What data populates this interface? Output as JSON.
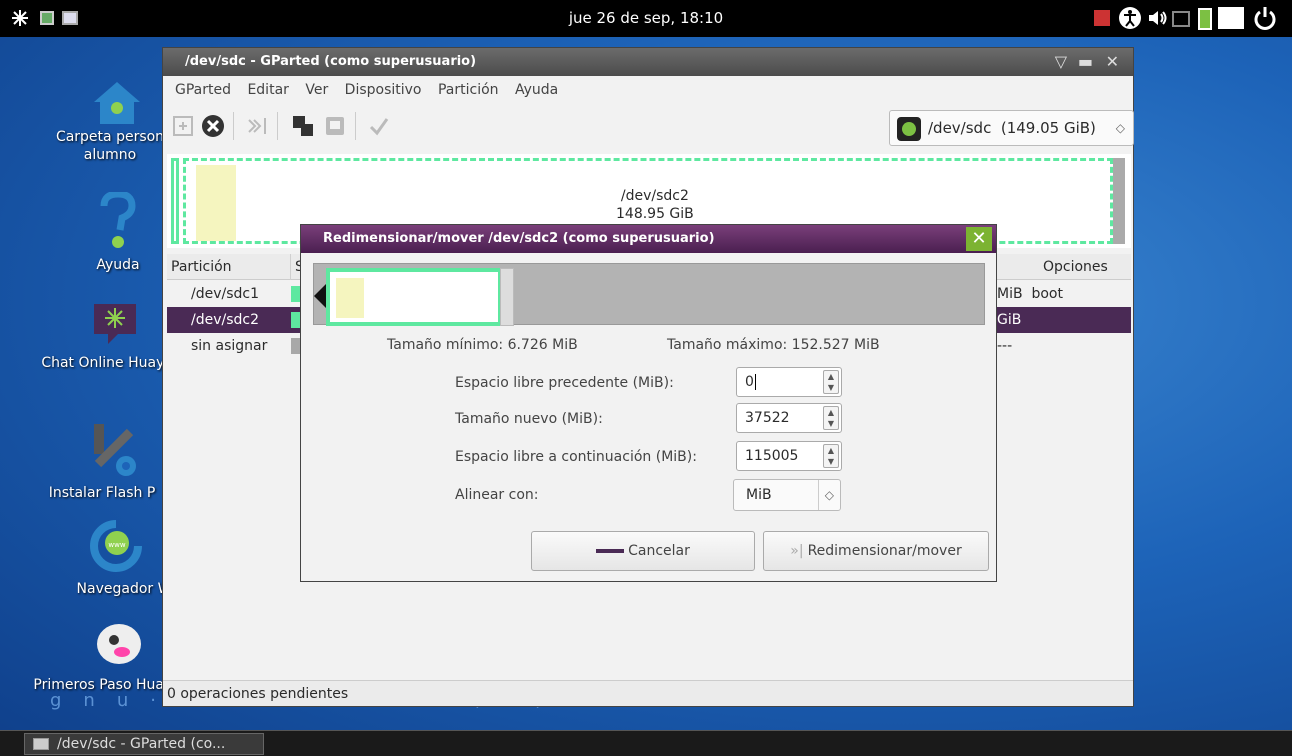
{
  "topbar": {
    "clock": "jue 26 de sep, 18:10"
  },
  "desktop": {
    "icons": [
      {
        "label": "Carpeta person alumno"
      },
      {
        "label": "Ayuda"
      },
      {
        "label": "Chat Online Huayra"
      },
      {
        "label": "Instalar Flash P"
      },
      {
        "label": "Navegador W"
      },
      {
        "label": "Primeros Paso Huayra"
      }
    ],
    "brand": "gnu·t·i·n·u·+·/·\\"
  },
  "taskbar": {
    "window_button": "/dev/sdc - GParted (co..."
  },
  "main_window": {
    "title": "/dev/sdc - GParted (como superusuario)",
    "menu": [
      "GParted",
      "Editar",
      "Ver",
      "Dispositivo",
      "Partición",
      "Ayuda"
    ],
    "device_selector": "/dev/sdc  (149.05 GiB)",
    "graph": {
      "partition": "/dev/sdc2",
      "size": "148.95 GiB"
    },
    "list": {
      "headers": {
        "partition": "Partición",
        "fs_initial": "S",
        "options": "Opciones"
      },
      "rows": [
        {
          "name": "/dev/sdc1",
          "right": "MiB  boot",
          "color": "#5ee8a0"
        },
        {
          "name": "/dev/sdc2",
          "right": "GiB",
          "color": "#5ee8a0"
        },
        {
          "name": "sin asignar",
          "right": "---",
          "color": "#a8a8a8"
        }
      ]
    },
    "status": "0 operaciones pendientes"
  },
  "dialog": {
    "title": "Redimensionar/mover /dev/sdc2 (como superusuario)",
    "min_size": "Tamaño mínimo: 6.726 MiB",
    "max_size": "Tamaño máximo: 152.527 MiB",
    "fields": {
      "free_before_label": "Espacio libre precedente (MiB):",
      "free_before_value": "0",
      "new_size_label": "Tamaño nuevo (MiB):",
      "new_size_value": "37522",
      "free_after_label": "Espacio libre a continuación (MiB):",
      "free_after_value": "115005",
      "align_label": "Alinear con:",
      "align_value": "MiB"
    },
    "buttons": {
      "cancel": "Cancelar",
      "resize": "Redimensionar/mover"
    }
  }
}
